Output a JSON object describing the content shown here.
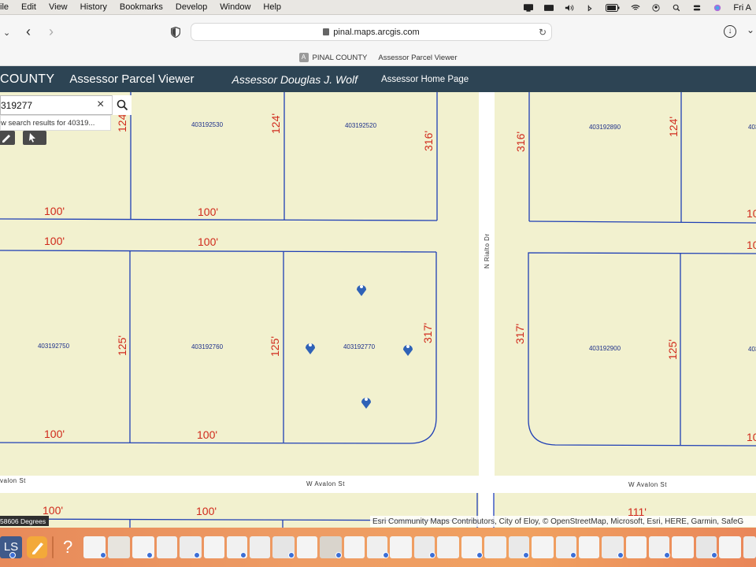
{
  "menubar": {
    "items": [
      "ile",
      "Edit",
      "View",
      "History",
      "Bookmarks",
      "Develop",
      "Window",
      "Help"
    ],
    "clock": "Fri A"
  },
  "browser": {
    "url": "pinal.maps.arcgis.com",
    "tab_badge": "A",
    "tab_title": "PINAL COUNTY",
    "tab_subtitle": "Assessor Parcel Viewer"
  },
  "header": {
    "county": "COUNTY",
    "title": "Assessor Parcel Viewer",
    "assessor": "Assessor Douglas J. Wolf",
    "home_link": "Assessor Home Page"
  },
  "search": {
    "value": "319277",
    "clear_icon": "×",
    "suggestion": "w search results for 40319..."
  },
  "map": {
    "parcels": [
      {
        "id": "403192530"
      },
      {
        "id": "403192520"
      },
      {
        "id": "403192890"
      },
      {
        "id": "403192750"
      },
      {
        "id": "403192760"
      },
      {
        "id": "403192770"
      },
      {
        "id": "403192900"
      }
    ],
    "partial_parcel_ids": [
      "403",
      "403"
    ],
    "dimensions": [
      "124'",
      "124'",
      "316'",
      "316'",
      "124'",
      "100'",
      "100'",
      "100'",
      "100'",
      "100'",
      "125'",
      "125'",
      "317'",
      "317'",
      "125'",
      "100'",
      "100'",
      "100'",
      "100'",
      "111'",
      "10",
      "10",
      "10"
    ],
    "streets": [
      "N Rialto Dr",
      "W Avalon St",
      "W Avalon St",
      "valon St"
    ],
    "scale_text": "58606 Degrees",
    "attribution": "Esri Community Maps Contributors, City of Eloy, © OpenStreetMap, Microsoft, Esri, HERE, Garmin, SafeG"
  },
  "colors": {
    "header_bg": "#2d4454",
    "parcel_fill": "#f2f1cf",
    "parcel_line": "#1f3fb5",
    "dimension_text": "#d02a1c",
    "parcel_id_text": "#1c2f8a",
    "road": "#ffffff",
    "marker": "#2f62b7"
  },
  "dock": {
    "left_label": "LS"
  }
}
